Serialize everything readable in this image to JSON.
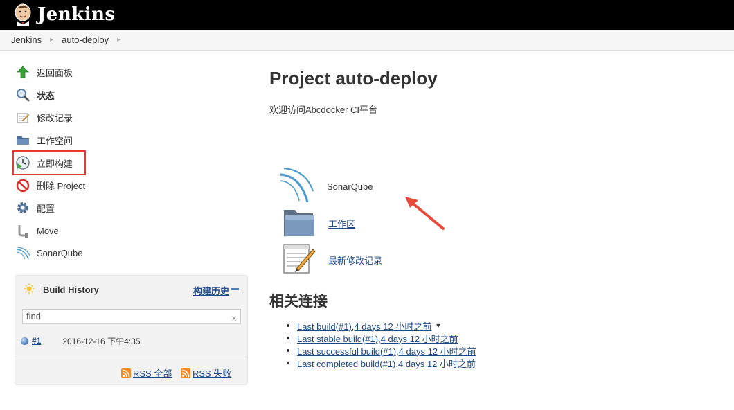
{
  "header": {
    "app_name": "Jenkins"
  },
  "breadcrumb": {
    "items": [
      "Jenkins",
      "auto-deploy"
    ]
  },
  "sidebar": {
    "tasks": [
      {
        "label": "返回面板",
        "icon": "up-arrow-icon"
      },
      {
        "label": "状态",
        "icon": "magnifier-icon",
        "bold": true
      },
      {
        "label": "修改记录",
        "icon": "notepad-icon"
      },
      {
        "label": "工作空间",
        "icon": "folder-icon"
      },
      {
        "label": "立即构建",
        "icon": "clock-build-icon",
        "highlighted": true
      },
      {
        "label": "删除 Project",
        "icon": "no-entry-icon"
      },
      {
        "label": "配置",
        "icon": "gear-icon"
      },
      {
        "label": "Move",
        "icon": "pipe-icon"
      },
      {
        "label": "SonarQube",
        "icon": "sonarqube-icon"
      }
    ]
  },
  "build_history": {
    "title": "Build History",
    "trend_link": "构建历史",
    "search_value": "find",
    "clear_label": "x",
    "builds": [
      {
        "number": "#1",
        "date": "2016-12-16 下午4:35"
      }
    ],
    "rss_all": "RSS 全部",
    "rss_failed": "RSS 失败"
  },
  "main": {
    "title": "Project auto-deploy",
    "description": "欢迎访问Abcdocker CI平台",
    "actions": [
      {
        "label": "SonarQube",
        "icon": "sonarqube-icon",
        "link": false
      },
      {
        "label": "工作区",
        "icon": "folder-icon",
        "link": true
      },
      {
        "label": "最新修改记录",
        "icon": "notepad-icon",
        "link": true
      }
    ],
    "permalinks_title": "相关连接",
    "permalinks": [
      "Last build(#1),4 days 12 小时之前",
      "Last stable build(#1),4 days 12 小时之前",
      "Last successful build(#1),4 days 12 小时之前",
      "Last completed build(#1),4 days 12 小时之前"
    ]
  },
  "colors": {
    "header_bg": "#000000",
    "link": "#204a87",
    "highlight_box": "#e03c31",
    "annotation_arrow": "#e84a3c"
  }
}
